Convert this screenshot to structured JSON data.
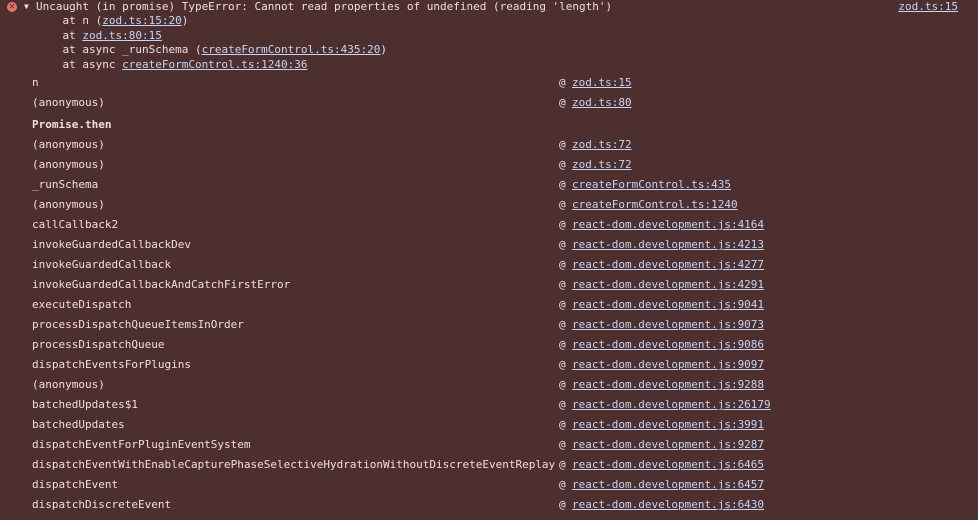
{
  "error": {
    "icon": "error-circle-icon",
    "expand_glyph": "▼",
    "message": "Uncaught (in promise) TypeError: Cannot read properties of undefined (reading 'length')",
    "source_link": "zod.ts:15",
    "trace_lines": [
      {
        "prefix": "    at n (",
        "link": "zod.ts:15:20",
        "suffix": ")"
      },
      {
        "prefix": "    at ",
        "link": "zod.ts:80:15",
        "suffix": ""
      },
      {
        "prefix": "    at async _runSchema (",
        "link": "createFormControl.ts:435:20",
        "suffix": ")"
      },
      {
        "prefix": "    at async ",
        "link": "createFormControl.ts:1240:36",
        "suffix": ""
      }
    ]
  },
  "stack": [
    {
      "fn": "n",
      "loc": "zod.ts:15"
    },
    {
      "fn": "(anonymous)",
      "loc": "zod.ts:80"
    },
    {
      "fn": "Promise.then",
      "loc": "",
      "async": true
    },
    {
      "fn": "(anonymous)",
      "loc": "zod.ts:72"
    },
    {
      "fn": "(anonymous)",
      "loc": "zod.ts:72"
    },
    {
      "fn": "_runSchema",
      "loc": "createFormControl.ts:435"
    },
    {
      "fn": "(anonymous)",
      "loc": "createFormControl.ts:1240"
    },
    {
      "fn": "callCallback2",
      "loc": "react-dom.development.js:4164"
    },
    {
      "fn": "invokeGuardedCallbackDev",
      "loc": "react-dom.development.js:4213"
    },
    {
      "fn": "invokeGuardedCallback",
      "loc": "react-dom.development.js:4277"
    },
    {
      "fn": "invokeGuardedCallbackAndCatchFirstError",
      "loc": "react-dom.development.js:4291"
    },
    {
      "fn": "executeDispatch",
      "loc": "react-dom.development.js:9041"
    },
    {
      "fn": "processDispatchQueueItemsInOrder",
      "loc": "react-dom.development.js:9073"
    },
    {
      "fn": "processDispatchQueue",
      "loc": "react-dom.development.js:9086"
    },
    {
      "fn": "dispatchEventsForPlugins",
      "loc": "react-dom.development.js:9097"
    },
    {
      "fn": "(anonymous)",
      "loc": "react-dom.development.js:9288"
    },
    {
      "fn": "batchedUpdates$1",
      "loc": "react-dom.development.js:26179"
    },
    {
      "fn": "batchedUpdates",
      "loc": "react-dom.development.js:3991"
    },
    {
      "fn": "dispatchEventForPluginEventSystem",
      "loc": "react-dom.development.js:9287"
    },
    {
      "fn": "dispatchEventWithEnableCapturePhaseSelectiveHydrationWithoutDiscreteEventReplay",
      "loc": "react-dom.development.js:6465"
    },
    {
      "fn": "dispatchEvent",
      "loc": "react-dom.development.js:6457"
    },
    {
      "fn": "dispatchDiscreteEvent",
      "loc": "react-dom.development.js:6430"
    }
  ],
  "at_symbol": "@",
  "colors": {
    "background": "#4e2f2f",
    "text": "#f1dede",
    "link": "#c5d5f5",
    "error_icon": "#e5736c"
  }
}
